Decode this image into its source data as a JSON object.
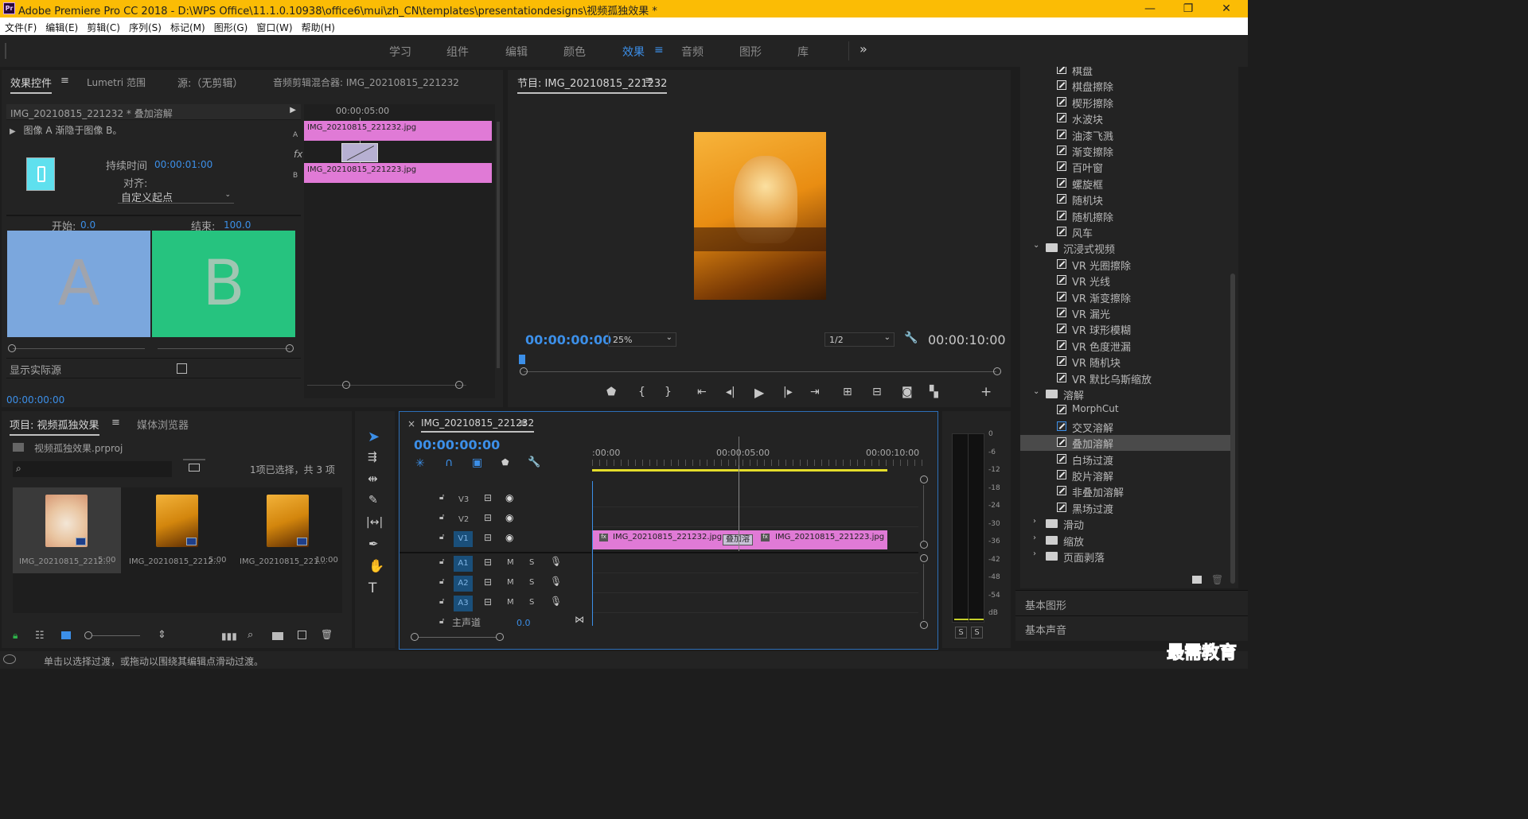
{
  "window": {
    "title": "Adobe Premiere Pro CC 2018 - D:\\WPS Office\\11.1.0.10938\\office6\\mui\\zh_CN\\templates\\presentationdesigns\\视频孤独效果 *",
    "app_icon": "Pr",
    "controls": [
      "—",
      "❐",
      "✕"
    ]
  },
  "menu": [
    "文件(F)",
    "编辑(E)",
    "剪辑(C)",
    "序列(S)",
    "标记(M)",
    "图形(G)",
    "窗口(W)",
    "帮助(H)"
  ],
  "workspaces": {
    "tabs": [
      "学习",
      "组件",
      "编辑",
      "颜色",
      "效果",
      "音频",
      "图形",
      "库"
    ],
    "active": "效果",
    "overflow": "»"
  },
  "effect_controls": {
    "tabs": [
      "效果控件",
      "Lumetri 范围",
      "源:（无剪辑）",
      "音频剪辑混合器: IMG_20210815_221232"
    ],
    "clip_header": "IMG_20210815_221232 * 叠加溶解",
    "description": "图像 A 渐隐于图像 B。",
    "duration_label": "持续时间",
    "duration_value": "00:00:01:00",
    "align_label": "对齐:",
    "align_value": "自定义起点",
    "start_label": "开始:",
    "start_value": "0.0",
    "end_label": "结束:",
    "end_value": "100.0",
    "preview_a": "A",
    "preview_b": "B",
    "show_actual_label": "显示实际源",
    "timecode": "00:00:00:00",
    "mini_ruler": "00:00:05:00",
    "track_a_label": "A",
    "track_b_label": "B",
    "fx_label": "fx",
    "clip_a": "IMG_20210815_221232.jpg",
    "clip_b": "IMG_20210815_221223.jpg"
  },
  "program_monitor": {
    "title": "节目: IMG_20210815_221232",
    "timecode_current": "00:00:00:00",
    "zoom": "25%",
    "resolution": "1/2",
    "timecode_duration": "00:00:10:00"
  },
  "effects_tree": {
    "items": [
      {
        "label": "棋盘",
        "type": "effect"
      },
      {
        "label": "棋盘擦除",
        "type": "effect"
      },
      {
        "label": "楔形擦除",
        "type": "effect"
      },
      {
        "label": "水波块",
        "type": "effect"
      },
      {
        "label": "油漆飞溅",
        "type": "effect"
      },
      {
        "label": "渐变擦除",
        "type": "effect"
      },
      {
        "label": "百叶窗",
        "type": "effect"
      },
      {
        "label": "螺旋框",
        "type": "effect"
      },
      {
        "label": "随机块",
        "type": "effect"
      },
      {
        "label": "随机擦除",
        "type": "effect"
      },
      {
        "label": "风车",
        "type": "effect"
      },
      {
        "label": "沉浸式视频",
        "type": "folder-open"
      },
      {
        "label": "VR 光圈擦除",
        "type": "effect"
      },
      {
        "label": "VR 光线",
        "type": "effect"
      },
      {
        "label": "VR 渐变擦除",
        "type": "effect"
      },
      {
        "label": "VR 漏光",
        "type": "effect"
      },
      {
        "label": "VR 球形模糊",
        "type": "effect"
      },
      {
        "label": "VR 色度泄漏",
        "type": "effect"
      },
      {
        "label": "VR 随机块",
        "type": "effect"
      },
      {
        "label": "VR 默比乌斯缩放",
        "type": "effect"
      },
      {
        "label": "溶解",
        "type": "folder-open"
      },
      {
        "label": "MorphCut",
        "type": "effect"
      },
      {
        "label": "交叉溶解",
        "type": "effect-default"
      },
      {
        "label": "叠加溶解",
        "type": "effect-selected"
      },
      {
        "label": "白场过渡",
        "type": "effect"
      },
      {
        "label": "胶片溶解",
        "type": "effect"
      },
      {
        "label": "非叠加溶解",
        "type": "effect"
      },
      {
        "label": "黑场过渡",
        "type": "effect"
      },
      {
        "label": "滑动",
        "type": "folder"
      },
      {
        "label": "缩放",
        "type": "folder"
      },
      {
        "label": "页面剥落",
        "type": "folder"
      }
    ],
    "sections": [
      "基本图形",
      "基本声音"
    ]
  },
  "project": {
    "tabs": [
      "项目: 视频孤独效果",
      "媒体浏览器"
    ],
    "file": "视频孤独效果.prproj",
    "selection_info": "1项已选择，共 3 项",
    "items": [
      {
        "name": "IMG_20210815_2212...",
        "duration": "5:00"
      },
      {
        "name": "IMG_20210815_2212...",
        "duration": "5:00"
      },
      {
        "name": "IMG_20210815_221...",
        "duration": "10:00"
      }
    ]
  },
  "timeline": {
    "title": "IMG_20210815_221232",
    "timecode": "00:00:00:00",
    "ruler": [
      ":00:00",
      "00:00:05:00",
      "00:00:10:00"
    ],
    "video_tracks": [
      "V3",
      "V2",
      "V1"
    ],
    "audio_tracks": [
      "A1",
      "A2",
      "A3"
    ],
    "master_label": "主声道",
    "master_value": "0.0",
    "clip1": "IMG_20210815_221232.jpg",
    "clip2": "IMG_20210815_221223.jpg",
    "transition": "叠加溶",
    "m": "M",
    "s": "S"
  },
  "audio_meter": {
    "scale": [
      "0",
      "-6",
      "-12",
      "-18",
      "-24",
      "-30",
      "-36",
      "-42",
      "-48",
      "-54",
      "dB"
    ],
    "solo": [
      "S",
      "S"
    ]
  },
  "status_bar": {
    "text": "单击以选择过渡，或拖动以围绕其编辑点滑动过渡。"
  },
  "watermark": "最需教育",
  "colors": {
    "titlebar": "#fbbc05",
    "accent_blue": "#3c8fe8",
    "clip_pink": "#e07ad6",
    "preview_a": "#7ba7dd",
    "preview_b": "#26c37f"
  }
}
